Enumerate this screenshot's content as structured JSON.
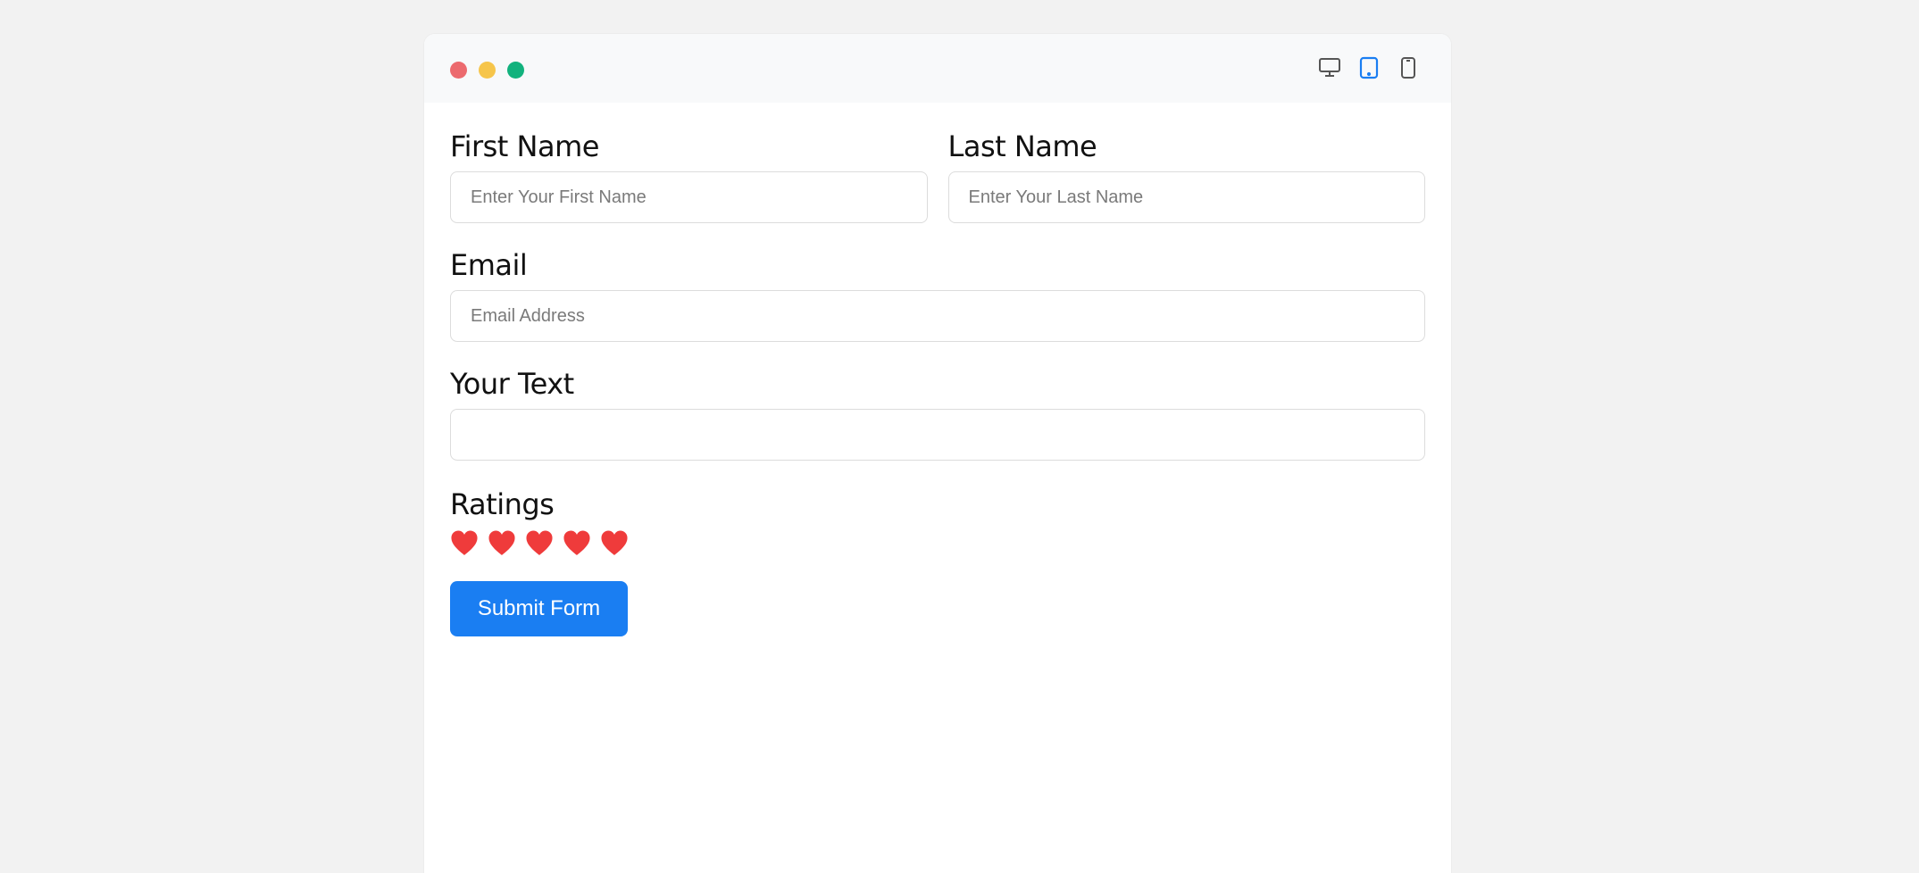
{
  "window": {
    "controls": [
      {
        "name": "close",
        "color": "#ec6a6e"
      },
      {
        "name": "minimize",
        "color": "#f6c54a"
      },
      {
        "name": "maximize",
        "color": "#12b27d"
      }
    ],
    "device_toggle": {
      "options": [
        "desktop",
        "tablet",
        "mobile"
      ],
      "selected": "tablet",
      "active_color": "#1a7ef2",
      "inactive_color": "#555555"
    }
  },
  "form": {
    "first_name": {
      "label": "First Name",
      "placeholder": "Enter Your First Name",
      "value": ""
    },
    "last_name": {
      "label": "Last Name",
      "placeholder": "Enter Your Last Name",
      "value": ""
    },
    "email": {
      "label": "Email",
      "placeholder": "Email Address",
      "value": ""
    },
    "your_text": {
      "label": "Your Text",
      "placeholder": "",
      "value": ""
    },
    "ratings": {
      "label": "Ratings",
      "count": 5,
      "max": 5,
      "heart_color": "#ef3b3b"
    },
    "submit": {
      "label": "Submit Form",
      "color": "#1a7ef2"
    }
  }
}
